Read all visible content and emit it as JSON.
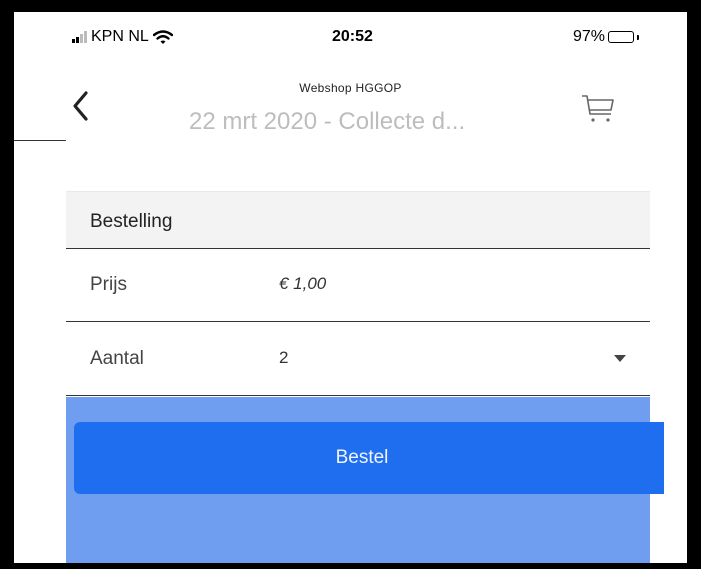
{
  "status_bar": {
    "carrier": "KPN NL",
    "time": "20:52",
    "battery": "97%",
    "battery_level": 0.97
  },
  "nav": {
    "subtitle": "Webshop HGGOP",
    "title": "22 mrt 2020 - Collecte d...",
    "back_icon": "chevron-left-icon",
    "cart_icon": "shopping-cart-icon"
  },
  "order": {
    "section_title": "Bestelling",
    "price_label": "Prijs",
    "price_value": "€ 1,00",
    "quantity_label": "Aantal",
    "quantity_value": "2"
  },
  "actions": {
    "order_button": "Bestel"
  },
  "colors": {
    "button": "#1f6ef0",
    "button_area": "#6f9ef0",
    "section_bg": "#f3f3f3"
  }
}
